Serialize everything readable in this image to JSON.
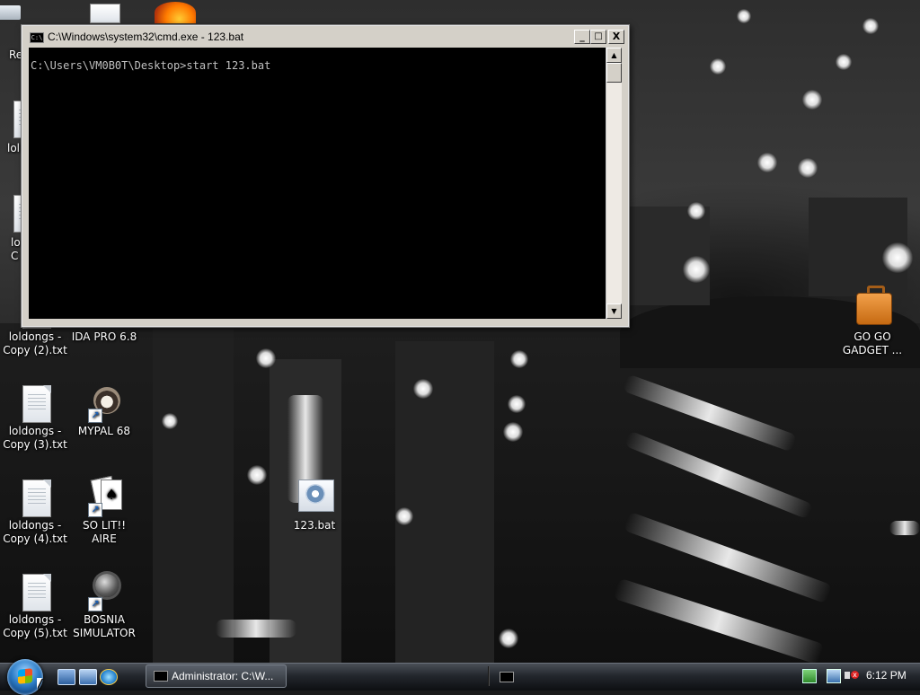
{
  "colors": {
    "console_bg": "#000000",
    "console_text": "#c0c0c0",
    "taskbar": "#1c1f24",
    "window_frame": "#d4d0c8"
  },
  "desktop": {
    "icons": [
      {
        "label": "Re",
        "icon": "recycle-bin-icon"
      },
      {
        "label": "lol",
        "icon": "text-file-icon"
      },
      {
        "label": "lo\nC",
        "icon": "text-file-icon"
      },
      {
        "label": "loldongs -\nCopy (2).txt",
        "icon": "text-file-icon"
      },
      {
        "label": "loldongs -\nCopy (3).txt",
        "icon": "text-file-icon"
      },
      {
        "label": "loldongs -\nCopy (4).txt",
        "icon": "text-file-icon"
      },
      {
        "label": "loldongs -\nCopy (5).txt",
        "icon": "text-file-icon"
      },
      {
        "label": "IDA PRO 6.8",
        "icon": "ida-pro-icon"
      },
      {
        "label": "MYPAL 68",
        "icon": "raccoon-icon"
      },
      {
        "label": "SO LIT!! AIRE",
        "icon": "solitaire-icon"
      },
      {
        "label": "BOSNIA\nSIMULATOR",
        "icon": "mine-icon"
      },
      {
        "label": "123.bat",
        "icon": "batch-file-icon"
      },
      {
        "label": "GO GO\nGADGET ...",
        "icon": "briefcase-icon"
      }
    ]
  },
  "cmd_window": {
    "title": "C:\\Windows\\system32\\cmd.exe - 123.bat",
    "minimize": "_",
    "maximize": "□",
    "close": "X",
    "console_line": "C:\\Users\\VM0B0T\\Desktop>start 123.bat",
    "scroll_up": "▲",
    "scroll_down": "▼"
  },
  "taskbar": {
    "start_icon": "windows-start-orb-icon",
    "quick_launch": [
      "show-desktop-icon",
      "switch-windows-icon",
      "internet-explorer-icon"
    ],
    "task_button_label": "Administrator: C:\\W...",
    "clock": "6:12 PM",
    "tray_icons": [
      "network-icon",
      "volume-muted-icon"
    ]
  }
}
